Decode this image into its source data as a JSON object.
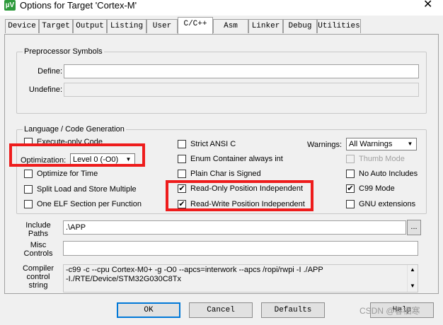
{
  "window": {
    "title": "Options for Target 'Cortex-M'",
    "icon_text": "µV",
    "close_glyph": "✕"
  },
  "tabs": [
    {
      "label": "Device"
    },
    {
      "label": "Target"
    },
    {
      "label": "Output"
    },
    {
      "label": "Listing"
    },
    {
      "label": "User"
    },
    {
      "label": "C/C++"
    },
    {
      "label": "Asm"
    },
    {
      "label": "Linker"
    },
    {
      "label": "Debug"
    },
    {
      "label": "Utilities"
    }
  ],
  "active_tab": "C/C++",
  "preprocessor": {
    "group_title": "Preprocessor Symbols",
    "define_label": "Define:",
    "define_value": "",
    "undefine_label": "Undefine:",
    "undefine_value": ""
  },
  "language": {
    "group_title": "Language / Code Generation",
    "execute_only": {
      "label": "Execute-only Code",
      "checked": false
    },
    "optimization_label": "Optimization:",
    "optimization_value": "Level 0 (-O0)",
    "optimize_time": {
      "label": "Optimize for Time",
      "checked": false
    },
    "split_load": {
      "label": "Split Load and Store Multiple",
      "checked": false
    },
    "one_elf": {
      "label": "One ELF Section per Function",
      "checked": false
    },
    "strict_ansi": {
      "label": "Strict ANSI C",
      "checked": false
    },
    "enum_container": {
      "label": "Enum Container always int",
      "checked": false
    },
    "plain_char": {
      "label": "Plain Char is Signed",
      "checked": false
    },
    "ropi": {
      "label": "Read-Only Position Independent",
      "checked": true
    },
    "rwpi": {
      "label": "Read-Write Position Independent",
      "checked": true
    },
    "warnings_label": "Warnings:",
    "warnings_value": "All Warnings",
    "thumb_mode": {
      "label": "Thumb Mode",
      "checked": false,
      "disabled": true
    },
    "no_auto_includes": {
      "label": "No Auto Includes",
      "checked": false
    },
    "c99_mode": {
      "label": "C99 Mode",
      "checked": true
    },
    "gnu_extensions": {
      "label": "GNU extensions",
      "checked": false
    }
  },
  "include_paths": {
    "label_line1": "Include",
    "label_line2": "Paths",
    "value": ".\\APP",
    "browse_label": "..."
  },
  "misc_controls": {
    "label_line1": "Misc",
    "label_line2": "Controls",
    "value": ""
  },
  "compiler_control": {
    "label_line1": "Compiler",
    "label_line2": "control",
    "label_line3": "string",
    "line1": "-c99 -c --cpu Cortex-M0+ -g -O0 --apcs=interwork --apcs /ropi/rwpi -I ./APP",
    "line2": "-I./RTE/Device/STM32G030C8Tx"
  },
  "buttons": {
    "ok": "OK",
    "cancel": "Cancel",
    "defaults": "Defaults",
    "help": "Help"
  },
  "check_glyph": "✔",
  "watermark": "CSDN @春栖寒",
  "colors": {
    "highlight": "#ee1c1c",
    "dialog_bg": "#f0f0f0",
    "app_icon": "#2e9a3c"
  }
}
